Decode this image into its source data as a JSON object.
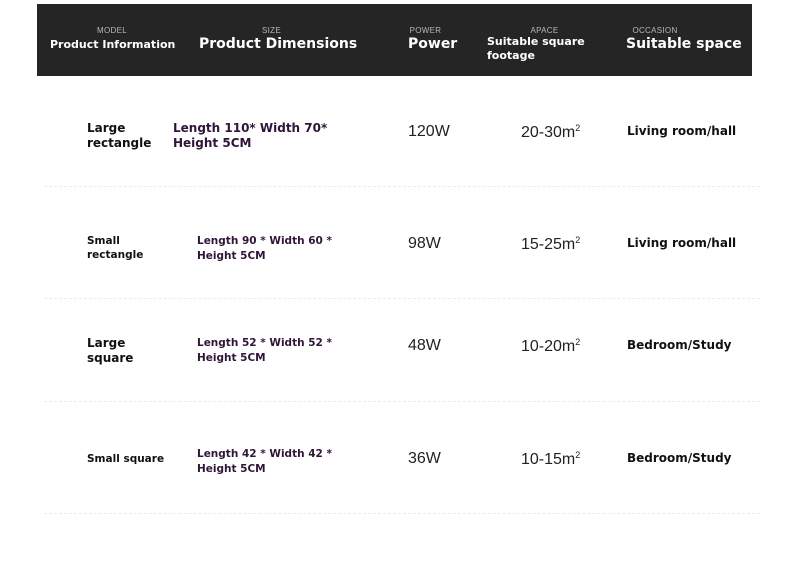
{
  "header": {
    "columns": [
      {
        "small": "MODEL",
        "big": "Product Information"
      },
      {
        "small": "SIZE",
        "big": "Product Dimensions"
      },
      {
        "small": "POWER",
        "big": "Power"
      },
      {
        "small": "APACE",
        "big": "Suitable square footage"
      },
      {
        "small": "OCCASION",
        "big": "Suitable space"
      }
    ]
  },
  "rows": [
    {
      "model": "Large rectangle",
      "size": "Length 110* Width 70* Height 5CM",
      "power": "120W",
      "area": "20-30m",
      "area_unit_sup": "2",
      "space": "Living room/hall"
    },
    {
      "model": "Small rectangle",
      "size": "Length 90 * Width 60 * Height 5CM",
      "power": "98W",
      "area": "15-25m",
      "area_unit_sup": "2",
      "space": "Living room/hall"
    },
    {
      "model": "Large square",
      "size": "Length 52 * Width 52 * Height 5CM",
      "power": "48W",
      "area": "10-20m",
      "area_unit_sup": "2",
      "space": "Bedroom/Study"
    },
    {
      "model": "Small square",
      "size": "Length 42 * Width 42 * Height 5CM",
      "power": "36W",
      "area": "10-15m",
      "area_unit_sup": "2",
      "space": "Bedroom/Study"
    }
  ]
}
